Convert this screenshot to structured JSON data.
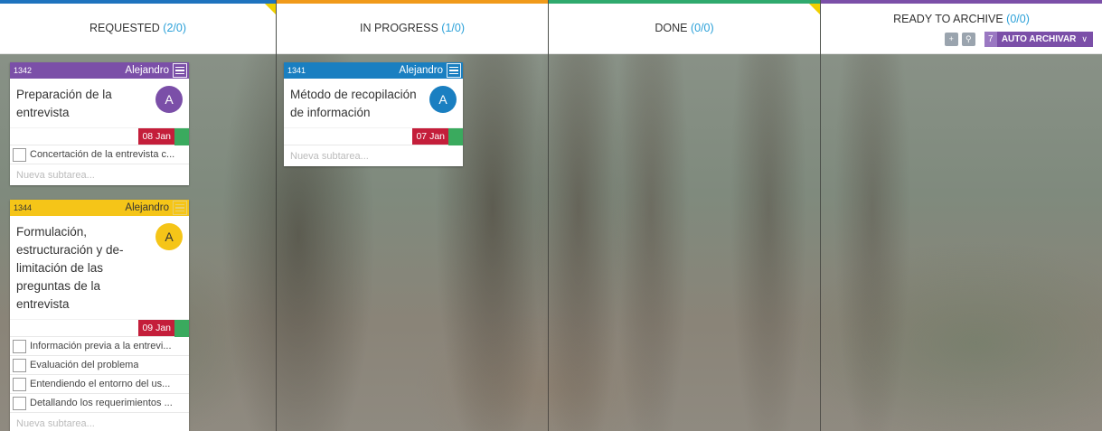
{
  "columns": [
    {
      "title": "REQUESTED",
      "count": "(2/0)",
      "color": "#1e73be"
    },
    {
      "title": "IN PROGRESS",
      "count": "(1/0)",
      "color": "#f09a1a"
    },
    {
      "title": "DONE",
      "count": "(0/0)",
      "color": "#2faa6e"
    },
    {
      "title": "READY TO ARCHIVE",
      "count": "(0/0)",
      "color": "#7b4fa8"
    }
  ],
  "archive_tools": {
    "add_icon": "plus-icon",
    "search_icon": "search-icon",
    "auto_count": "7",
    "auto_label": "AUTO ARCHIVAR"
  },
  "cards": [
    {
      "id": "1342",
      "owner": "Alejandro",
      "title": "Preparación de la entrevista",
      "avatar": "A",
      "header_color": "#7b4fa8",
      "avatar_color": "#7b4fa8",
      "date": "08 Jan",
      "subtasks": [
        "Concertación de la entrevista c..."
      ],
      "new_subtask_placeholder": "Nueva subtarea..."
    },
    {
      "id": "1344",
      "owner": "Alejandro",
      "title": "Formulación, estructuración y de-limitación de las preguntas de la entrevista",
      "avatar": "A",
      "header_color": "#f5c518",
      "avatar_color": "#f5c518",
      "date": "09 Jan",
      "subtasks": [
        "Información previa a la entrevi...",
        "Evaluación del problema",
        "Entendiendo el entorno del us...",
        "Detallando los requerimientos ..."
      ],
      "new_subtask_placeholder": "Nueva subtarea..."
    },
    {
      "id": "1341",
      "owner": "Alejandro",
      "title": "Método de recopilación de información",
      "avatar": "A",
      "header_color": "#1a7fc1",
      "avatar_color": "#1a7fc1",
      "date": "07 Jan",
      "subtasks": [],
      "new_subtask_placeholder": "Nueva subtarea..."
    }
  ]
}
